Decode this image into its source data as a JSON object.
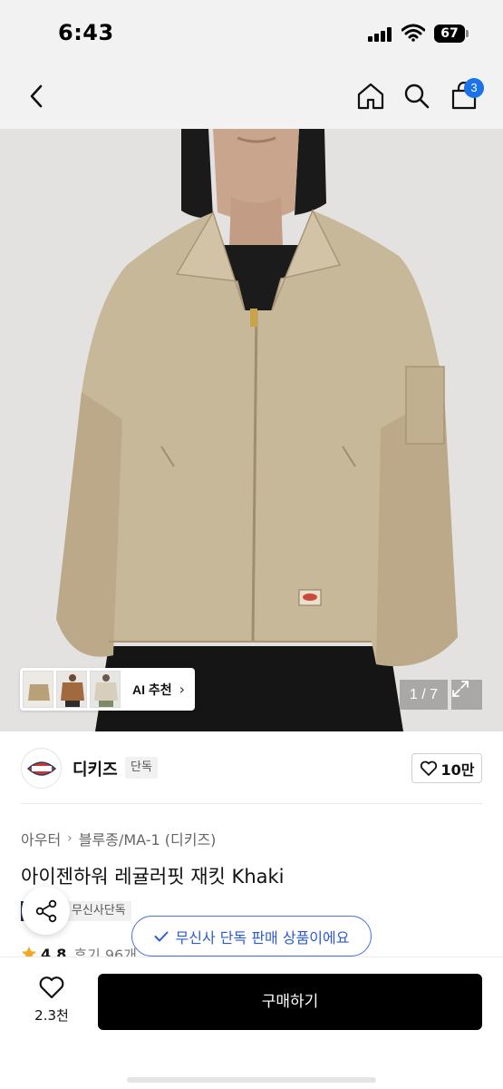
{
  "status_bar": {
    "time": "6:43",
    "battery": "67"
  },
  "nav": {
    "cart_count": "3"
  },
  "gallery": {
    "ai_label": "AI 추천",
    "page_counter": "1 / 7"
  },
  "brand": {
    "name": "디키즈",
    "tag": "단독",
    "likes": "10만"
  },
  "breadcrumb": {
    "category": "아우터",
    "subcategory": "블루종/MA-1 (디키즈)"
  },
  "product": {
    "title": "아이젠하워 레귤러핏 재킷 Khaki",
    "tag_dark": "이",
    "tag_light": "무신사단독",
    "exclusive_notice": "무신사 단독 판매 상품이에요",
    "rating": "4.8",
    "reviews": "후기 96개"
  },
  "bottom_bar": {
    "wish_count": "2.3천",
    "buy_label": "구매하기"
  },
  "colors": {
    "accent_blue": "#1a73e8",
    "pill_blue": "#2b5bd4",
    "jacket_khaki": "#c8b89a",
    "tag_navy": "#1e2a44"
  }
}
